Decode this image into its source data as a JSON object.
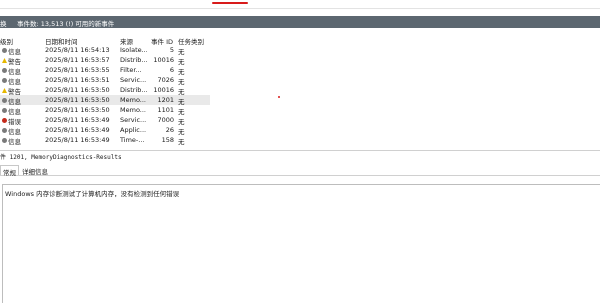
{
  "toolbar": {
    "accent": "#d81b1b"
  },
  "title": {
    "pane_label": "换",
    "event_count": "事件数: 13,513 (!) 可用的新事件"
  },
  "columns": {
    "level": "级别",
    "date": "日期和时间",
    "source": "来源",
    "event_id": "事件 ID",
    "category": "任务类别"
  },
  "events": [
    {
      "level": "信息",
      "icon": "info-icon",
      "date": "2025/8/11 16:54:13",
      "source": "Isolate...",
      "id": "5",
      "category": "无"
    },
    {
      "level": "警告",
      "icon": "warning-icon",
      "date": "2025/8/11 16:53:57",
      "source": "Distrib...",
      "id": "10016",
      "category": "无"
    },
    {
      "level": "信息",
      "icon": "info-icon",
      "date": "2025/8/11 16:53:55",
      "source": "Filter...",
      "id": "6",
      "category": "无"
    },
    {
      "level": "信息",
      "icon": "info-icon",
      "date": "2025/8/11 16:53:51",
      "source": "Servic...",
      "id": "7026",
      "category": "无"
    },
    {
      "level": "警告",
      "icon": "warning-icon",
      "date": "2025/8/11 16:53:50",
      "source": "Distrib...",
      "id": "10016",
      "category": "无"
    },
    {
      "level": "信息",
      "icon": "info-icon",
      "date": "2025/8/11 16:53:50",
      "source": "Memo...",
      "id": "1201",
      "category": "无"
    },
    {
      "level": "信息",
      "icon": "info-icon",
      "date": "2025/8/11 16:53:50",
      "source": "Memo...",
      "id": "1101",
      "category": "无"
    },
    {
      "level": "错误",
      "icon": "error-icon",
      "date": "2025/8/11 16:53:49",
      "source": "Servic...",
      "id": "7000",
      "category": "无"
    },
    {
      "level": "信息",
      "icon": "info-icon",
      "date": "2025/8/11 16:53:49",
      "source": "Applic...",
      "id": "26",
      "category": "无"
    },
    {
      "level": "信息",
      "icon": "info-icon",
      "date": "2025/8/11 16:53:49",
      "source": "Time-...",
      "id": "158",
      "category": "无"
    }
  ],
  "detail": {
    "title": "件 1201, MemoryDiagnostics-Results",
    "tabs": [
      "常规",
      "详细信息"
    ],
    "message": "Windows 内存诊断测试了计算机内存，没有检测到任何错误"
  }
}
